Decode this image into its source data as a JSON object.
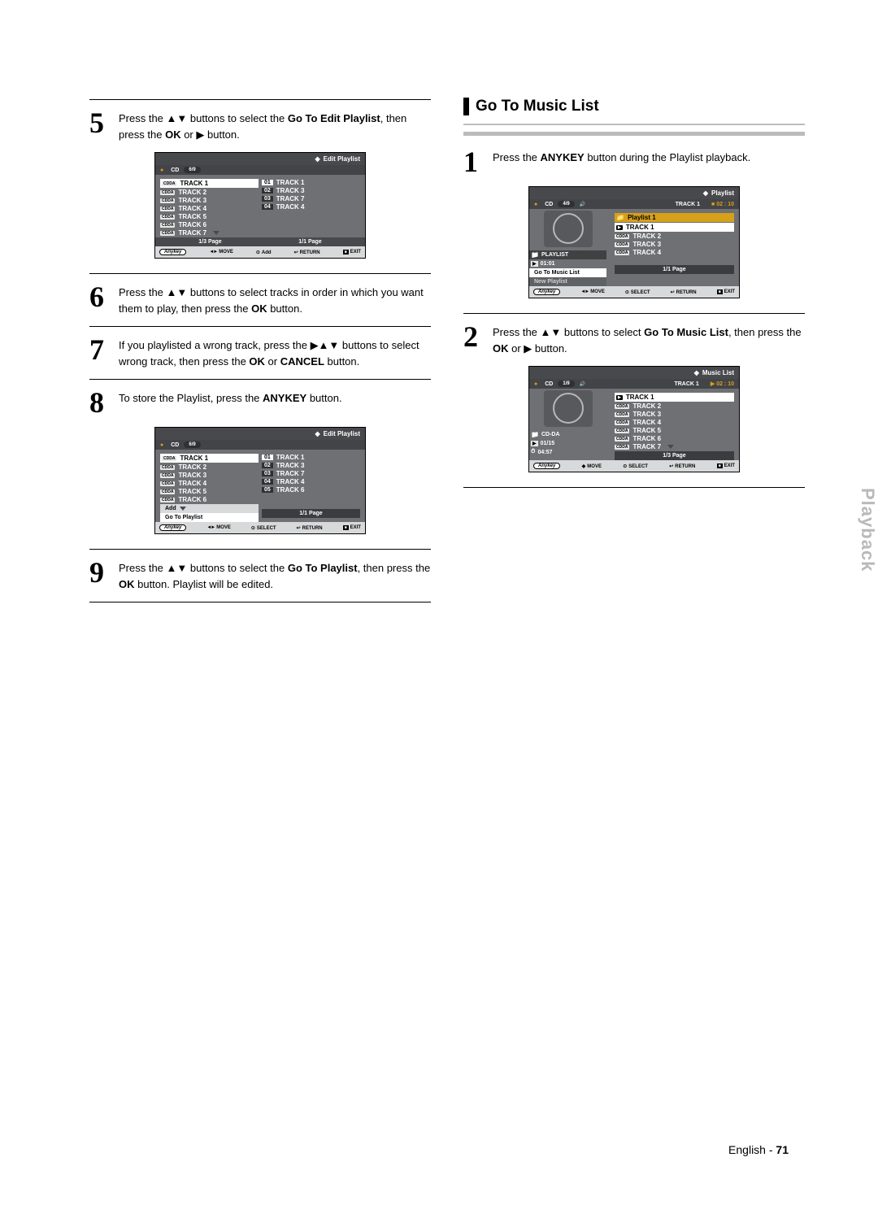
{
  "footer": {
    "lang": "English",
    "page": "71"
  },
  "sidetab": "Playback",
  "section_right_title": "Go To Music List",
  "steps_left": {
    "s5": {
      "num": "5",
      "t1": "Press the ",
      "t2": "▲▼",
      "t3": " buttons to select the ",
      "t4": "Go To Edit Playlist",
      "t5": ", then press the ",
      "t6": "OK",
      "t7": " or ",
      "t8": "▶",
      "t9": " button."
    },
    "s6": {
      "num": "6",
      "t1": "Press the ",
      "t2": "▲▼",
      "t3": " buttons to select tracks in order in which you want them to play, then press the ",
      "t4": "OK",
      "t5": " button."
    },
    "s7": {
      "num": "7",
      "t1": "If you playlisted a wrong track, press the ",
      "t2": "▶▲▼",
      "t3": " buttons to select wrong track, then press the ",
      "t4": "OK",
      "t5": " or ",
      "t6": "CANCEL",
      "t7": " button."
    },
    "s8": {
      "num": "8",
      "t1": "To store the Playlist, press the ",
      "t2": "ANYKEY",
      "t3": " button."
    },
    "s9": {
      "num": "9",
      "t1": "Press the ",
      "t2": "▲▼",
      "t3": " buttons to select the ",
      "t4": "Go To Playlist",
      "t5": ", then press the ",
      "t6": "OK",
      "t7": " button. Playlist will be edited."
    }
  },
  "steps_right": {
    "s1": {
      "num": "1",
      "t1": "Press the ",
      "t2": "ANYKEY",
      "t3": " button during the Playlist playback."
    },
    "s2": {
      "num": "2",
      "t1": "Press the ",
      "t2": "▲▼",
      "t3": " buttons to select ",
      "t4": "Go To Music List",
      "t5": ", then press the ",
      "t6": "OK",
      "t7": " or ",
      "t8": "▶",
      "t9": " button."
    }
  },
  "osd1": {
    "title": "Edit Playlist",
    "cd": "CD",
    "count": "6/9",
    "left": [
      "TRACK 1",
      "TRACK 2",
      "TRACK 3",
      "TRACK 4",
      "TRACK 5",
      "TRACK 6",
      "TRACK 7"
    ],
    "right_num": [
      "01",
      "02",
      "03",
      "04"
    ],
    "right": [
      "TRACK 1",
      "TRACK 3",
      "TRACK 7",
      "TRACK 4"
    ],
    "pager_l": "1/3 Page",
    "pager_r": "1/1 Page",
    "anykey": "Anykey",
    "move": "MOVE",
    "add": "Add",
    "return": "RETURN",
    "exit": "EXIT"
  },
  "osd2": {
    "title": "Edit Playlist",
    "cd": "CD",
    "count": "6/9",
    "left": [
      "TRACK 1",
      "TRACK 2",
      "TRACK 3",
      "TRACK 4",
      "TRACK 5",
      "TRACK 6"
    ],
    "add": "Add",
    "goto": "Go To Playlist",
    "right_num": [
      "01",
      "02",
      "03",
      "04",
      "05"
    ],
    "right": [
      "TRACK 1",
      "TRACK 3",
      "TRACK 7",
      "TRACK 4",
      "TRACK 6"
    ],
    "pager_r": "1/1 Page",
    "anykey": "Anykey",
    "move": "MOVE",
    "select": "SELECT",
    "return": "RETURN",
    "exit": "EXIT"
  },
  "osd3": {
    "title": "Playlist",
    "cd": "CD",
    "count": "4/9",
    "trk": "TRACK  1",
    "time": "02 : 10",
    "stop": "■",
    "pl1": "Playlist 1",
    "right": [
      "TRACK 1",
      "TRACK 2",
      "TRACK 3",
      "TRACK 4"
    ],
    "side_playlist": "PLAYLIST",
    "side_count": "01:01",
    "menu1": "Go To Music List",
    "menu2": "New Playlist",
    "pager_r": "1/1 Page",
    "anykey": "Anykey",
    "move": "MOVE",
    "select": "SELECT",
    "return": "RETURN",
    "exit": "EXIT"
  },
  "osd4": {
    "title": "Music List",
    "cd": "CD",
    "count": "1/9",
    "trk": "TRACK  1",
    "time": "02 : 10",
    "play": "▶",
    "right": [
      "TRACK 1",
      "TRACK 2",
      "TRACK 3",
      "TRACK 4",
      "TRACK 5",
      "TRACK 6",
      "TRACK 7"
    ],
    "side_cdda": "CD-DA",
    "side_count": "01/15",
    "side_time": "04:57",
    "pager_r": "1/3 Page",
    "anykey": "Anykey",
    "move": "MOVE",
    "select": "SELECT",
    "return": "RETURN",
    "exit": "EXIT"
  }
}
